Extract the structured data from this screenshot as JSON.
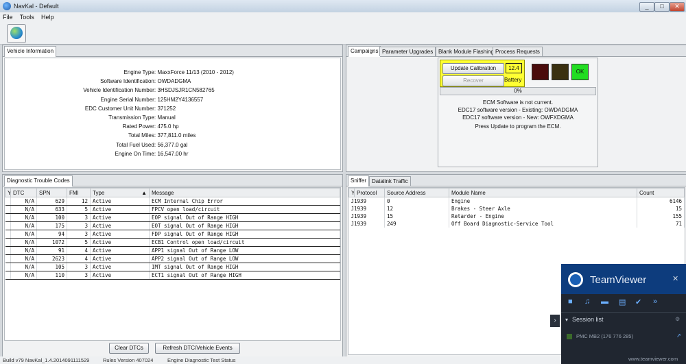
{
  "window": {
    "title": "NavKal - Default",
    "minimize": "_",
    "maximize": "□",
    "close": "✕"
  },
  "menu": [
    "File",
    "Tools",
    "Help"
  ],
  "vehicle_panel": {
    "tab": "Vehicle Information",
    "rows": [
      {
        "label": "Engine Type:",
        "value": "MaxxForce 11/13 (2010 - 2012)"
      },
      {
        "label": "Software Identification:",
        "value": "OWDADGMA"
      },
      {
        "label": "Vehicle Identification Number:",
        "value": "3HSDJSJR1CN582765"
      },
      {
        "label": "Engine Serial Number:",
        "value": "125HM2Y4136557"
      },
      {
        "label": "EDC Customer Unit Number:",
        "value": "371252"
      },
      {
        "label": "Transmission Type:",
        "value": "Manual"
      },
      {
        "label": "Rated Power:",
        "value": "475.0 hp"
      },
      {
        "label": "Total Miles:",
        "value": "377,811.0 miles"
      },
      {
        "label": "Total Fuel Used:",
        "value": "56,377.0 gal"
      },
      {
        "label": "Engine On Time:",
        "value": "16,547.00 hr"
      }
    ]
  },
  "campaigns_panel": {
    "tabs": [
      "Campaigns",
      "Parameter Upgrades",
      "Blank Module Flashing",
      "Process Requests"
    ],
    "update_button": "Update Calibration",
    "recover_button": "Recover",
    "battery_value": "12.4",
    "battery_label": "Battery",
    "ok_label": "OK",
    "progress": "0%",
    "messages": [
      "ECM Software is not current.",
      "EDC17 software version - Existing: OWDADGMA",
      "EDC17 software version - New: OWFXDGMA",
      "Press Update to program the ECM."
    ],
    "colors": {
      "stop": "#4a0c0c",
      "caution": "#3a3010",
      "ok": "#22dd22",
      "highlight": "#ffff33"
    }
  },
  "dtc_panel": {
    "tab": "Diagnostic Trouble Codes",
    "columns": [
      "DTC",
      "SPN",
      "FMI",
      "Type",
      "Message"
    ],
    "rows": [
      [
        "N/A",
        "629",
        "12",
        "Active",
        "ECM Internal Chip Error"
      ],
      [
        "N/A",
        "633",
        "5",
        "Active",
        "FPCV open load/circuit"
      ],
      [
        "N/A",
        "100",
        "3",
        "Active",
        "EOP signal Out of Range HIGH"
      ],
      [
        "N/A",
        "175",
        "3",
        "Active",
        "EOT signal Out of Range HIGH"
      ],
      [
        "N/A",
        "94",
        "3",
        "Active",
        "FDP signal Out of Range HIGH"
      ],
      [
        "N/A",
        "1072",
        "5",
        "Active",
        "ECB1 Control open load/circuit"
      ],
      [
        "N/A",
        "91",
        "4",
        "Active",
        "APP1 signal Out of Range LOW"
      ],
      [
        "N/A",
        "2623",
        "4",
        "Active",
        "APP2 signal Out of Range LOW"
      ],
      [
        "N/A",
        "105",
        "3",
        "Active",
        "IMT signal Out of Range HIGH"
      ],
      [
        "N/A",
        "110",
        "3",
        "Active",
        "ECT1 signal Out of Range HIGH"
      ]
    ],
    "clear_button": "Clear DTCs",
    "refresh_button": "Refresh DTC/Vehicle Events"
  },
  "sniffer_panel": {
    "tabs": [
      "Sniffer",
      "Datalink Traffic"
    ],
    "columns": [
      "Protocol",
      "Source Address",
      "Module Name",
      "Count"
    ],
    "rows": [
      [
        "J1939",
        "0",
        "Engine",
        "6146"
      ],
      [
        "J1939",
        "12",
        "Brakes - Steer Axle",
        "15"
      ],
      [
        "J1939",
        "15",
        "Retarder - Engine",
        "155"
      ],
      [
        "J1939",
        "249",
        "Off Board Diagnostic-Service Tool",
        "71"
      ]
    ]
  },
  "statusbar": {
    "build": "Build v79 NavKal_1.4.2014091111529",
    "rules": "Rules Version 407024",
    "status": "Engine Diagnostic Test Status"
  },
  "teamviewer": {
    "title": "TeamViewer",
    "session_list": "Session list",
    "session_item": "PMC MB2 (176 776 285)",
    "footer": "www.teamviewer.com",
    "close": "✕"
  }
}
